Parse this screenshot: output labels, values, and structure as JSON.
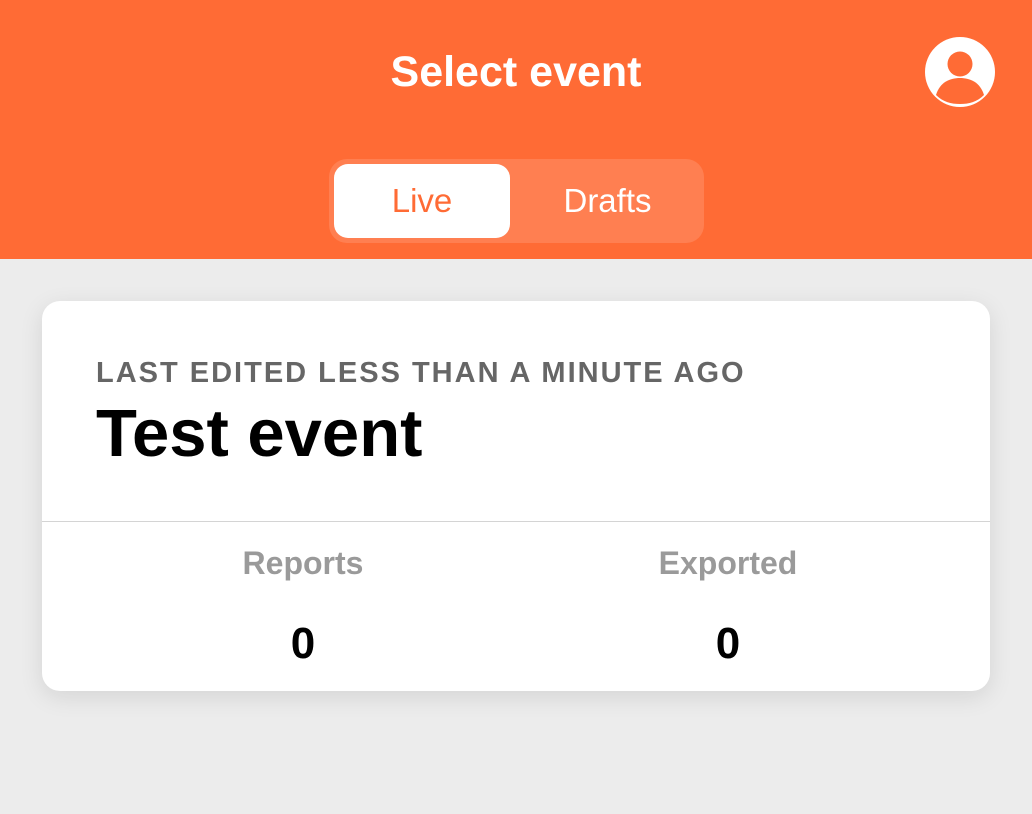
{
  "header": {
    "title": "Select event",
    "accent_color": "#ff6b35",
    "profile_icon": "user-circle-icon"
  },
  "tabs": [
    {
      "label": "Live",
      "selected": true
    },
    {
      "label": "Drafts",
      "selected": false
    }
  ],
  "events": [
    {
      "last_edited": "LAST EDITED LESS THAN A MINUTE AGO",
      "name": "Test event",
      "stats": [
        {
          "label": "Reports",
          "value": "0"
        },
        {
          "label": "Exported",
          "value": "0"
        }
      ]
    }
  ]
}
